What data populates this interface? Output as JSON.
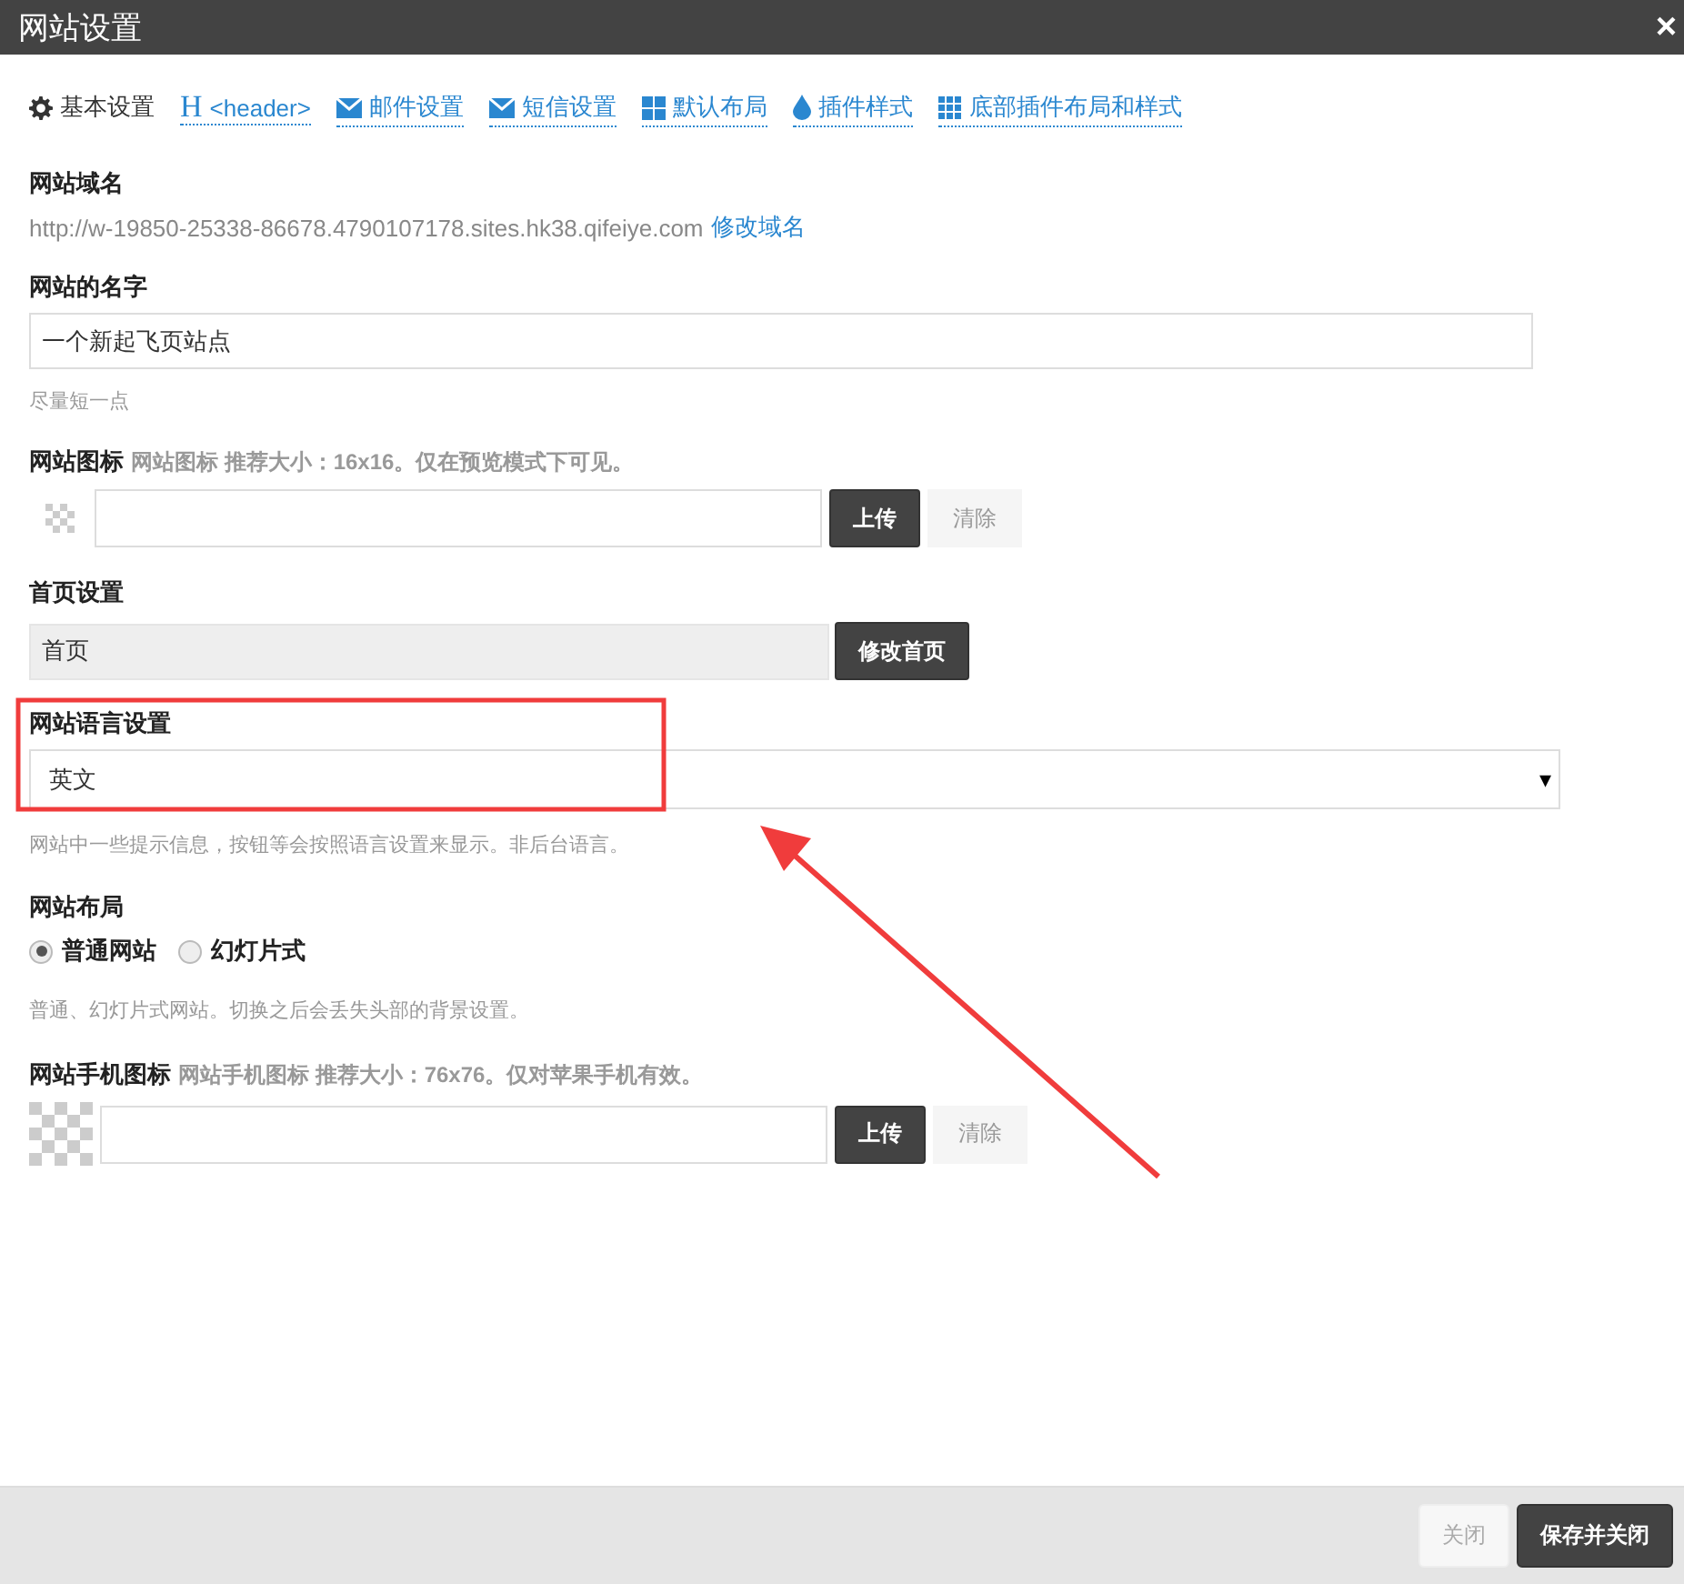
{
  "window": {
    "title": "网站设置",
    "close": "×"
  },
  "tabs": [
    {
      "label": "基本设置",
      "kind": "gear",
      "selected": true
    },
    {
      "label": "<header>",
      "kind": "heading",
      "icon_text": "H",
      "selected": false
    },
    {
      "label": "邮件设置",
      "kind": "envelope",
      "selected": false
    },
    {
      "label": "短信设置",
      "kind": "envelope",
      "selected": false
    },
    {
      "label": "默认布局",
      "kind": "grid4",
      "selected": false
    },
    {
      "label": "插件样式",
      "kind": "drop",
      "selected": false
    },
    {
      "label": "底部插件布局和样式",
      "kind": "grid9",
      "selected": false
    }
  ],
  "domain": {
    "label": "网站域名",
    "url": "http://w-19850-25338-86678.4790107178.sites.hk38.qifeiye.com",
    "link": "修改域名"
  },
  "site_name": {
    "label": "网站的名字",
    "value": "一个新起飞页站点",
    "hint": "尽量短一点"
  },
  "favicon": {
    "label": "网站图标",
    "note": "网站图标 推荐大小：16x16。仅在预览模式下可见。",
    "upload": "上传",
    "clear": "清除"
  },
  "homepage": {
    "label": "首页设置",
    "value": "首页",
    "disabled": true,
    "button": "修改首页"
  },
  "language": {
    "label": "网站语言设置",
    "value": "英文",
    "caret": "▾",
    "hint": "网站中一些提示信息，按钮等会按照语言设置来显示。非后台语言。"
  },
  "layout": {
    "label": "网站布局",
    "options": [
      {
        "label": "普通网站",
        "selected": true
      },
      {
        "label": "幻灯片式",
        "selected": false
      }
    ],
    "hint": "普通、幻灯片式网站。切换之后会丢失头部的背景设置。"
  },
  "mobile_icon": {
    "label": "网站手机图标",
    "note": "网站手机图标 推荐大小：76x76。仅对苹果手机有效。",
    "upload": "上传",
    "clear": "清除"
  },
  "footer": {
    "buttons": [
      {
        "label": "关闭",
        "kind": "secondary"
      },
      {
        "label": "保存并关闭",
        "kind": "primary"
      }
    ]
  }
}
